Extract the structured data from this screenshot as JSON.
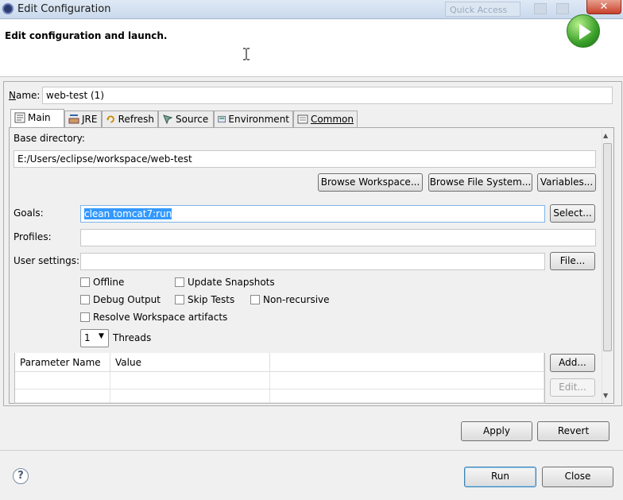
{
  "window": {
    "title": "Edit Configuration",
    "quick_access": "Quick Access",
    "close_label": "✕"
  },
  "header": {
    "text": "Edit configuration and launch."
  },
  "name": {
    "label": "Name:",
    "value": "web-test (1)"
  },
  "tabs": [
    {
      "label": "Main",
      "icon": "main-tab-icon"
    },
    {
      "label": "JRE",
      "icon": "jre-icon"
    },
    {
      "label": "Refresh",
      "icon": "refresh-icon"
    },
    {
      "label": "Source",
      "icon": "source-icon"
    },
    {
      "label": "Environment",
      "icon": "environment-icon"
    },
    {
      "label": "Common",
      "icon": "common-icon"
    }
  ],
  "main_tab": {
    "base_dir_label": "Base directory:",
    "base_dir_value": "E:/Users/eclipse/workspace/web-test",
    "browse_workspace": "Browse Workspace...",
    "browse_fs": "Browse File System...",
    "variables": "Variables...",
    "goals_label": "Goals:",
    "goals_value": "clean tomcat7:run",
    "select_btn": "Select...",
    "profiles_label": "Profiles:",
    "profiles_value": "",
    "user_settings_label": "User settings:",
    "user_settings_value": "",
    "file_btn": "File...",
    "checkboxes": {
      "offline": "Offline",
      "update_snapshots": "Update Snapshots",
      "debug_output": "Debug Output",
      "skip_tests": "Skip Tests",
      "non_recursive": "Non-recursive",
      "resolve_workspace": "Resolve Workspace artifacts"
    },
    "threads_value": "1",
    "threads_label": "Threads",
    "table": {
      "headers": [
        "Parameter Name",
        "Value"
      ]
    },
    "add_btn": "Add...",
    "edit_btn": "Edit..."
  },
  "apply_btn": "Apply",
  "revert_btn": "Revert",
  "run_btn": "Run",
  "close_btn": "Close",
  "help_symbol": "?"
}
